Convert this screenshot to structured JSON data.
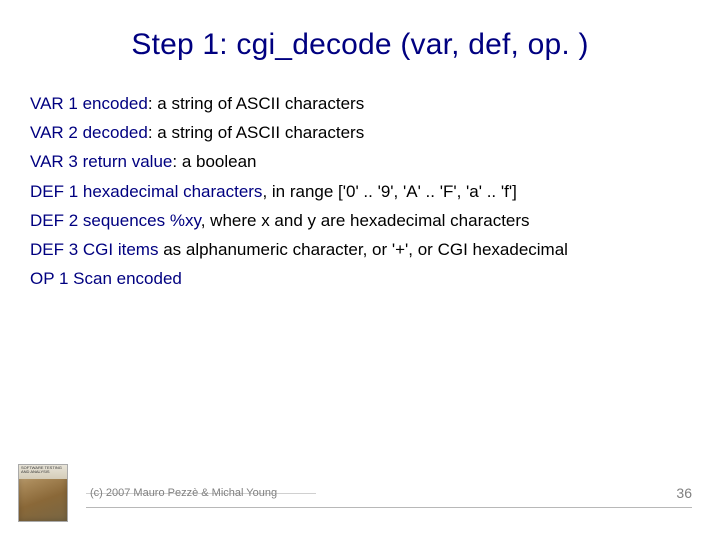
{
  "title": "Step 1: cgi_decode (var, def, op. )",
  "lines": [
    {
      "label": "VAR 1 encoded",
      "text": ": a string of ASCII characters"
    },
    {
      "label": "VAR 2 decoded",
      "text": ": a string of ASCII characters"
    },
    {
      "label": "VAR 3 return value",
      "text": ": a boolean"
    },
    {
      "label": "DEF 1 hexadecimal characters",
      "text": ", in range  ['0' .. '9', 'A' .. 'F', 'a' .. 'f']"
    },
    {
      "label": "DEF 2 sequences %xy",
      "text": ", where x and y are hexadecimal characters"
    },
    {
      "label": "DEF 3 CGI items",
      "text": " as alphanumeric character, or '+', or CGI hexadecimal"
    },
    {
      "label": "OP 1 Scan encoded",
      "text": ""
    }
  ],
  "thumb_caption": "SOFTWARE TESTING AND ANALYSIS",
  "copyright": "(c) 2007 Mauro Pezzè & Michal Young",
  "page_number": "36"
}
